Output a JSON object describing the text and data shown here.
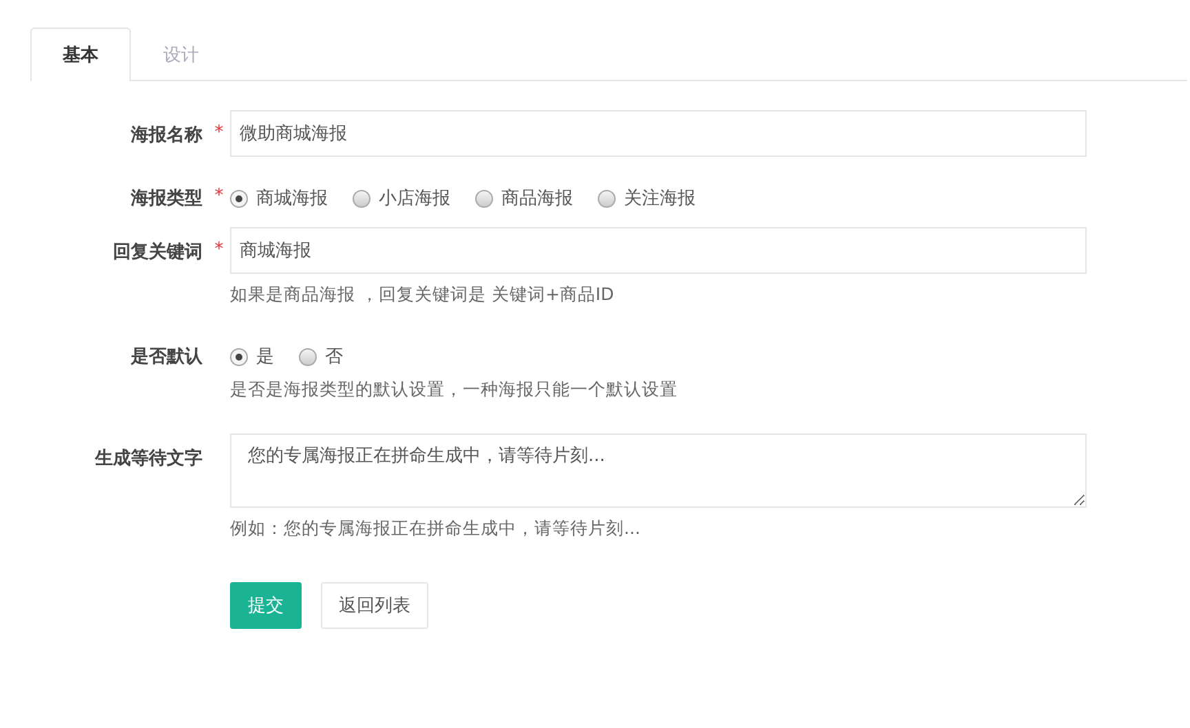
{
  "tabs": [
    {
      "label": "基本",
      "selected": true
    },
    {
      "label": "设计",
      "selected": false
    }
  ],
  "fields": [
    {
      "kind": "input",
      "label": "海报名称",
      "required_mark": "*",
      "value": "微助商城海报"
    },
    {
      "kind": "radio",
      "label": "海报类型",
      "required_mark": "*",
      "options": [
        {
          "label": "商城海报",
          "selected": true
        },
        {
          "label": "小店海报",
          "selected": false
        },
        {
          "label": "商品海报",
          "selected": false
        },
        {
          "label": "关注海报",
          "selected": false
        }
      ]
    },
    {
      "kind": "input",
      "label": "回复关键词",
      "required_mark": "*",
      "value": "商城海报",
      "help": "如果是商品海报 ，回复关键词是 关键词+商品ID"
    },
    {
      "kind": "radio",
      "label": "是否默认",
      "options": [
        {
          "label": "是",
          "selected": true
        },
        {
          "label": "否",
          "selected": false
        }
      ],
      "help": "是否是海报类型的默认设置，一种海报只能一个默认设置"
    },
    {
      "kind": "textarea",
      "label": "生成等待文字",
      "value": "您的专属海报正在拼命生成中，请等待片刻...",
      "help": "例如：您的专属海报正在拼命生成中，请等待片刻..."
    }
  ],
  "buttons": [
    {
      "label": "提交",
      "kind": "primary"
    },
    {
      "label": "返回列表",
      "kind": "default"
    }
  ]
}
